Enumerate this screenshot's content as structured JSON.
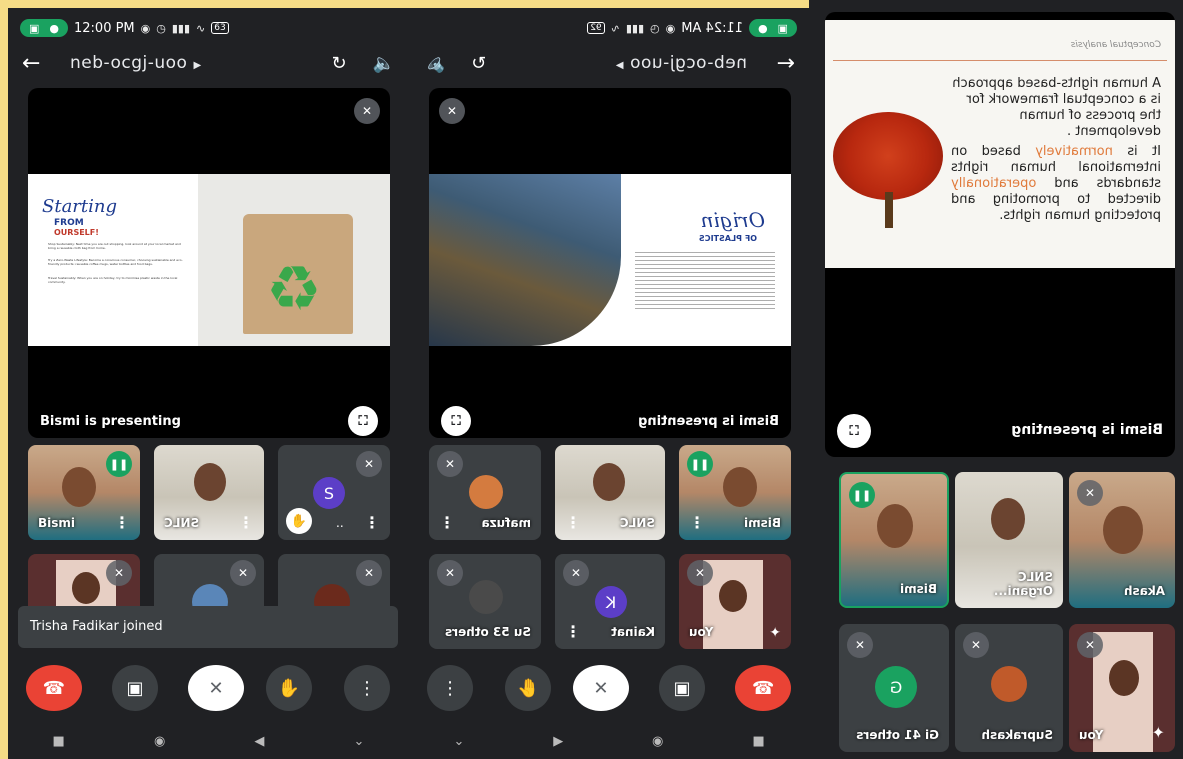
{
  "status_bar": {
    "time": "12:00 PM",
    "battery": "63"
  },
  "status_bar_2": {
    "time": "11:24 AM",
    "battery": "92"
  },
  "meeting": {
    "code": "neb-ocgj-uoo"
  },
  "presenting": {
    "label": "Bismi is presenting"
  },
  "toast": {
    "text": "Trisha Fadikar joined"
  },
  "slide_plastic": {
    "title_line1": "Starting",
    "title_line2": "FROM",
    "title_line3": "OURSELF!",
    "bullet1": "Shop Sustainably: Next time you are out shopping, look around at your local market and bring a reusable cloth bag from home.",
    "bullet2": "Try a Zero-Waste Lifestyle: Become a conscious consumer, choosing sustainable and eco-friendly products: reusable coffee mugs, water bottles and food bags.",
    "bullet3": "Travel Sustainably: When you are on holiday, try to minimise plastic waste in the local community."
  },
  "slide_origin": {
    "title": "Origin",
    "subtitle": "OF PLASTICS"
  },
  "slide_concept": {
    "header": "Conceptual analysis",
    "para1": "A human rights-based approach is a conceptual framework for the process of human development .",
    "para2_a": "It is",
    "para2_hl1": "normatively",
    "para2_b": "based on international human rights standards and",
    "para2_hl2": "operationally",
    "para2_c": "directed to promoting and protecting human rights."
  },
  "panel1": {
    "tiles": [
      {
        "name": "Bismi"
      },
      {
        "name": "SNLC"
      },
      {
        "name": "..",
        "initial": "S",
        "color": "#5c3ec7"
      },
      {
        "name": ""
      },
      {
        "name": ""
      },
      {
        "name": ""
      }
    ]
  },
  "panel2": {
    "tiles": [
      {
        "name": "mafuza"
      },
      {
        "name": "SNLC"
      },
      {
        "name": "Bismi"
      },
      {
        "name": "Su 53 others"
      },
      {
        "name": "Kainat",
        "initial": "K",
        "color": "#5c3ec7"
      },
      {
        "name": "You"
      }
    ]
  },
  "panel3": {
    "tiles": [
      {
        "name": "Bismi"
      },
      {
        "name": "SNLC Organi..."
      },
      {
        "name": "Akash"
      },
      {
        "name": "Gi 41 others",
        "initial": "G",
        "color": "#1aa260"
      },
      {
        "name": "Suprakash"
      },
      {
        "name": "You"
      }
    ]
  },
  "icons": {
    "back": "arrow-left-icon",
    "switch_camera": "camera-switch-icon",
    "speaker": "speaker-icon",
    "mic_off": "mic-off-icon",
    "fullscreen": "fullscreen-icon",
    "end_call": "end-call-icon",
    "camera": "camera-icon",
    "hand": "raise-hand-icon",
    "more": "more-vert-icon"
  },
  "colors": {
    "end_call": "#ea4335",
    "speaking": "#1aa260",
    "background": "#202124",
    "border": "#f5dc86"
  }
}
